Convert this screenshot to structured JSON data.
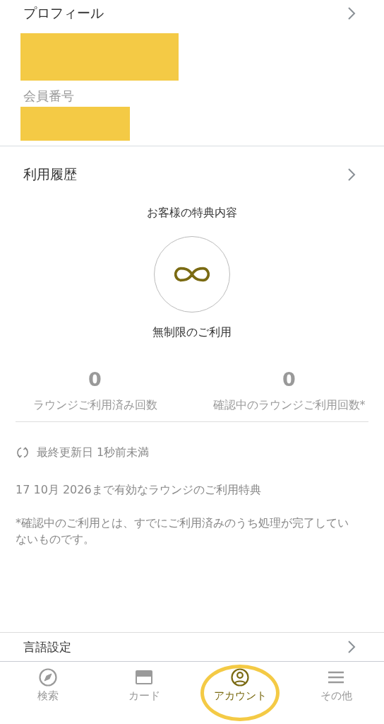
{
  "profile": {
    "title": "プロフィール",
    "items": [
      {
        "kind": "redacted"
      },
      {
        "kind": "label",
        "text": "会員番号"
      },
      {
        "kind": "redacted"
      }
    ]
  },
  "history": {
    "title": "利用履歴"
  },
  "benefit": {
    "heading": "お客様の特典内容",
    "caption": "無制限のご利用"
  },
  "stats": [
    {
      "value": "0",
      "label": "ラウンジご利用済み回数"
    },
    {
      "value": "0",
      "label": "確認中のラウンジご利用回数*"
    }
  ],
  "updated": "最終更新日 1秒前未満",
  "validity": "17 10月 2026まで有効なラウンジのご利用特典",
  "note": "*確認中のご利用とは、すでにご利用済みのうち処理が完了していないものです。",
  "language": {
    "title": "言語設定"
  },
  "nav": [
    {
      "label": "検索",
      "selected": false,
      "circled": false
    },
    {
      "label": "カード",
      "selected": false,
      "circled": false
    },
    {
      "label": "アカウント",
      "selected": true,
      "circled": true
    },
    {
      "label": "その他",
      "selected": false,
      "circled": false
    }
  ]
}
